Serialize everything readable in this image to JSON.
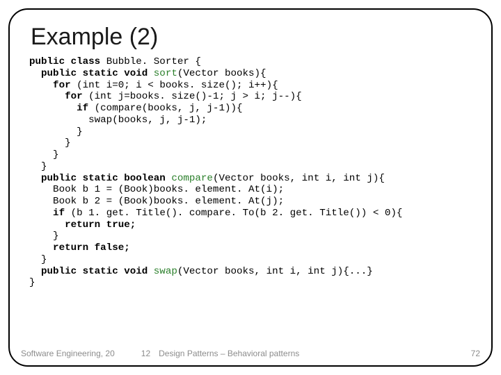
{
  "title": "Example (2)",
  "code": {
    "l01a": "public class ",
    "l01b": "Bubble. Sorter {",
    "l02a": "  public static void ",
    "l02b": "sort",
    "l02c": "(Vector books){",
    "l03a": "    for ",
    "l03b": "(int i=0; i < books. size(); i++){",
    "l04a": "      for ",
    "l04b": "(int j=books. size()-1; j > i; j--){",
    "l05a": "        if ",
    "l05b": "(compare(books, j, j-1)){",
    "l06": "          swap(books, j, j-1);",
    "l07": "        }",
    "l08": "      }",
    "l09": "    }",
    "l10": "  }",
    "l11a": "  public static boolean ",
    "l11b": "compare",
    "l11c": "(Vector books, int i, int j){",
    "l12": "    Book b 1 = (Book)books. element. At(i);",
    "l13": "    Book b 2 = (Book)books. element. At(j);",
    "l14a": "    if ",
    "l14b": "(b 1. get. Title(). compare. To(b 2. get. Title()) < 0){",
    "l15": "      return true;",
    "l16": "    }",
    "l17": "    return false;",
    "l18": "  }",
    "l19a": "  public static void ",
    "l19b": "swap",
    "l19c": "(Vector books, int i, int j){...}",
    "l20": "}"
  },
  "footer": {
    "subject": "Software Engineering, 20",
    "subnum": "12",
    "design": "Design Patterns – Behavioral patterns",
    "page": "72"
  }
}
